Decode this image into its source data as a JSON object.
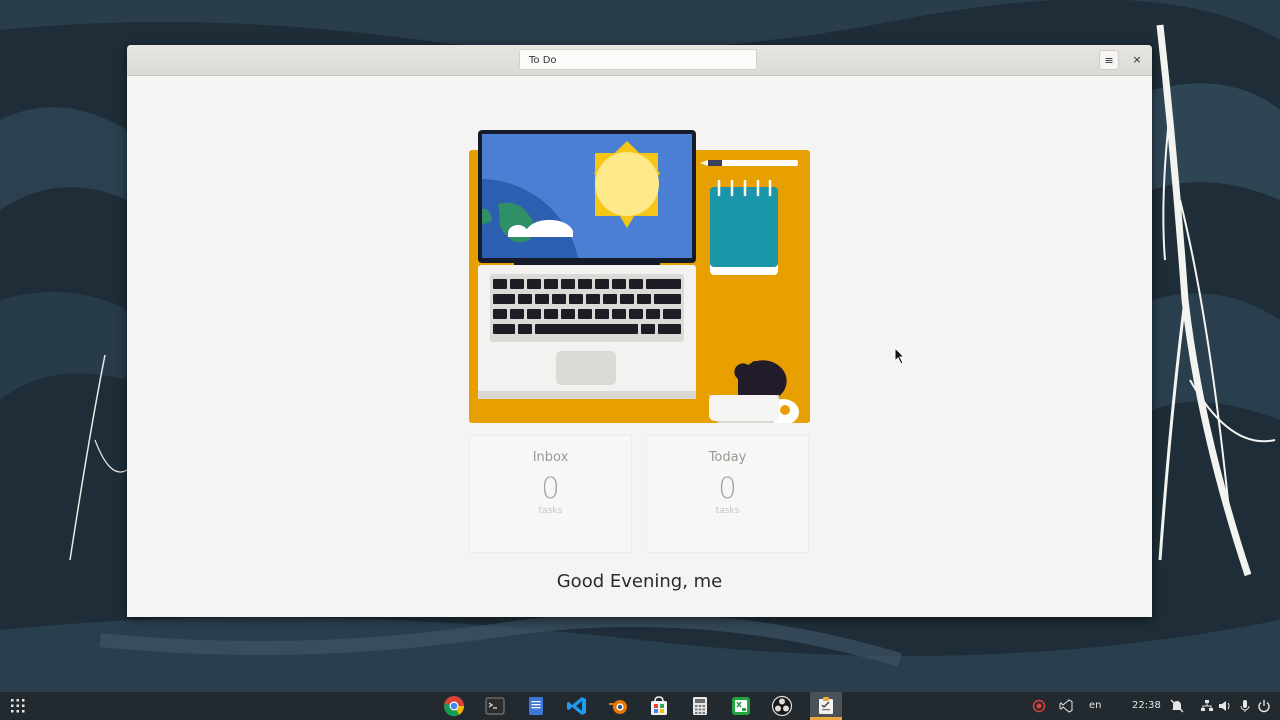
{
  "window": {
    "title": "To Do",
    "menu_icon": "hamburger-menu-icon",
    "close_icon": "close-icon",
    "close_glyph": "×",
    "menu_glyph": "≡"
  },
  "illustration": {
    "name": "workspace-illustration"
  },
  "cards": [
    {
      "title": "Inbox",
      "count": "0",
      "unit": "tasks"
    },
    {
      "title": "Today",
      "count": "0",
      "unit": "tasks"
    }
  ],
  "greeting": "Good Evening, me",
  "taskbar": {
    "apps": [
      "chrome-icon",
      "terminal-icon",
      "text-editor-icon",
      "vscode-icon",
      "blender-icon",
      "software-store-icon",
      "calculator-icon",
      "spreadsheet-icon",
      "obs-icon",
      "todo-app-icon"
    ],
    "language": "en",
    "clock": "22:38"
  },
  "colors": {
    "accent_orange": "#e8a000",
    "screen_blue": "#4a7fd4",
    "notepad_teal": "#1a96a8",
    "active_indicator": "#e8a93b"
  }
}
